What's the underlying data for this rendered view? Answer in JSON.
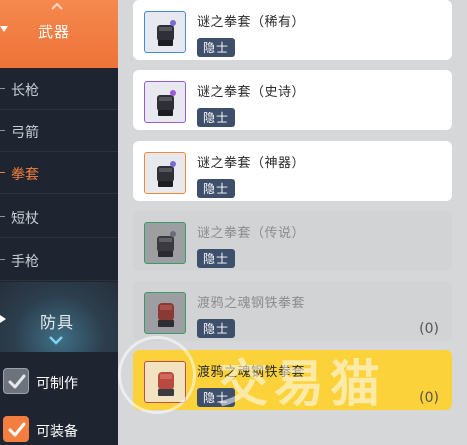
{
  "sidebar": {
    "weapon_category": {
      "label": "武器",
      "up_icon": "chevron-up-icon",
      "expand_icon": "caret-down-icon"
    },
    "weapon_subs": [
      {
        "label": "长枪",
        "active": false
      },
      {
        "label": "弓箭",
        "active": false
      },
      {
        "label": "拳套",
        "active": true
      },
      {
        "label": "短杖",
        "active": false
      },
      {
        "label": "手枪",
        "active": false
      }
    ],
    "armor_category": {
      "label": "防具",
      "expand_icon": "caret-right-icon",
      "down_icon": "chevron-down-icon"
    },
    "filters": [
      {
        "label": "可制作",
        "checked": true,
        "style": "grey"
      },
      {
        "label": "可装备",
        "checked": true,
        "style": "orange"
      }
    ]
  },
  "items": [
    {
      "name": "谜之拳套（稀有）",
      "tag": "隐士",
      "count": "",
      "frame_color": "#3d8fd6",
      "state": "normal"
    },
    {
      "name": "谜之拳套（史诗）",
      "tag": "隐士",
      "count": "",
      "frame_color": "#9a5bd6",
      "state": "normal"
    },
    {
      "name": "谜之拳套（神器）",
      "tag": "隐士",
      "count": "",
      "frame_color": "#ef8a3a",
      "state": "normal"
    },
    {
      "name": "谜之拳套（传说）",
      "tag": "隐士",
      "count": "",
      "frame_color": "#3b9a6a",
      "state": "dim"
    },
    {
      "name": "渡鸦之魂钢铁拳套",
      "tag": "隐士",
      "count": "(0)",
      "frame_color": "#3b9a6a",
      "state": "dim"
    },
    {
      "name": "渡鸦之魂钢铁拳套",
      "tag": "隐士",
      "count": "(0)",
      "frame_color": "#c94a4a",
      "state": "selected"
    }
  ],
  "watermark": {
    "text": "交易猫"
  },
  "colors": {
    "accent": "#f2803f",
    "selected": "#fcd23a",
    "badge": "#3d4f6a"
  }
}
